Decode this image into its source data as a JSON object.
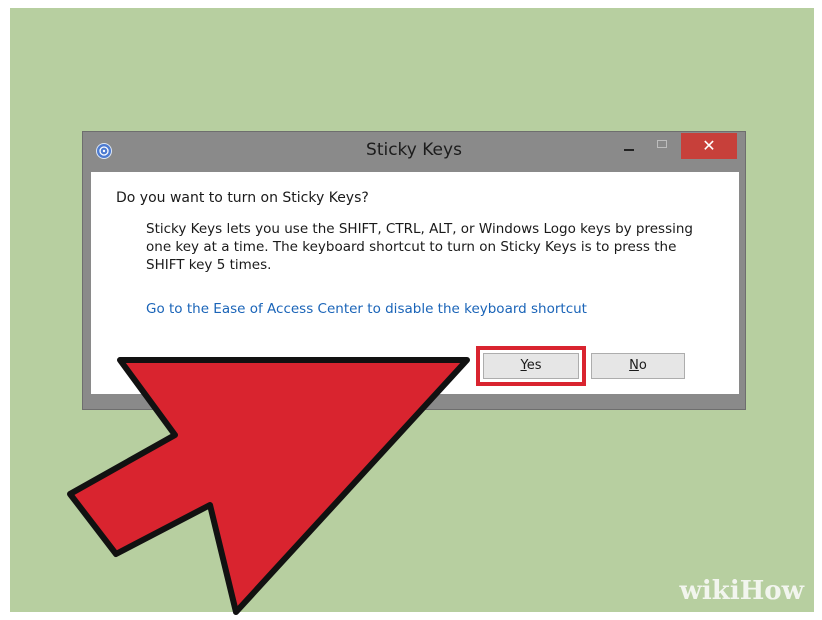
{
  "dialog": {
    "title": "Sticky Keys",
    "close_glyph": "✕",
    "question": "Do you want to turn on Sticky Keys?",
    "description": "Sticky Keys lets you use the SHIFT, CTRL, ALT, or Windows Logo keys by pressing one key at a time. The keyboard shortcut to turn on Sticky Keys is to press the SHIFT key 5 times.",
    "link": "Go to the Ease of Access Center to disable the keyboard shortcut",
    "yes_label_first": "Y",
    "yes_label_rest": "es",
    "no_label_first": "N",
    "no_label_rest": "o"
  },
  "watermark": {
    "part1": "wiki",
    "part2": "How"
  },
  "colors": {
    "background": "#b7cfa0",
    "highlight": "#d9242f",
    "arrow_fill": "#d9242f",
    "link": "#1a64b8"
  },
  "icons": {
    "app": "ease-of-access-icon",
    "minimize": "minimize-icon",
    "maximize": "maximize-icon",
    "close": "close-icon",
    "pointer": "red-arrow-icon"
  }
}
